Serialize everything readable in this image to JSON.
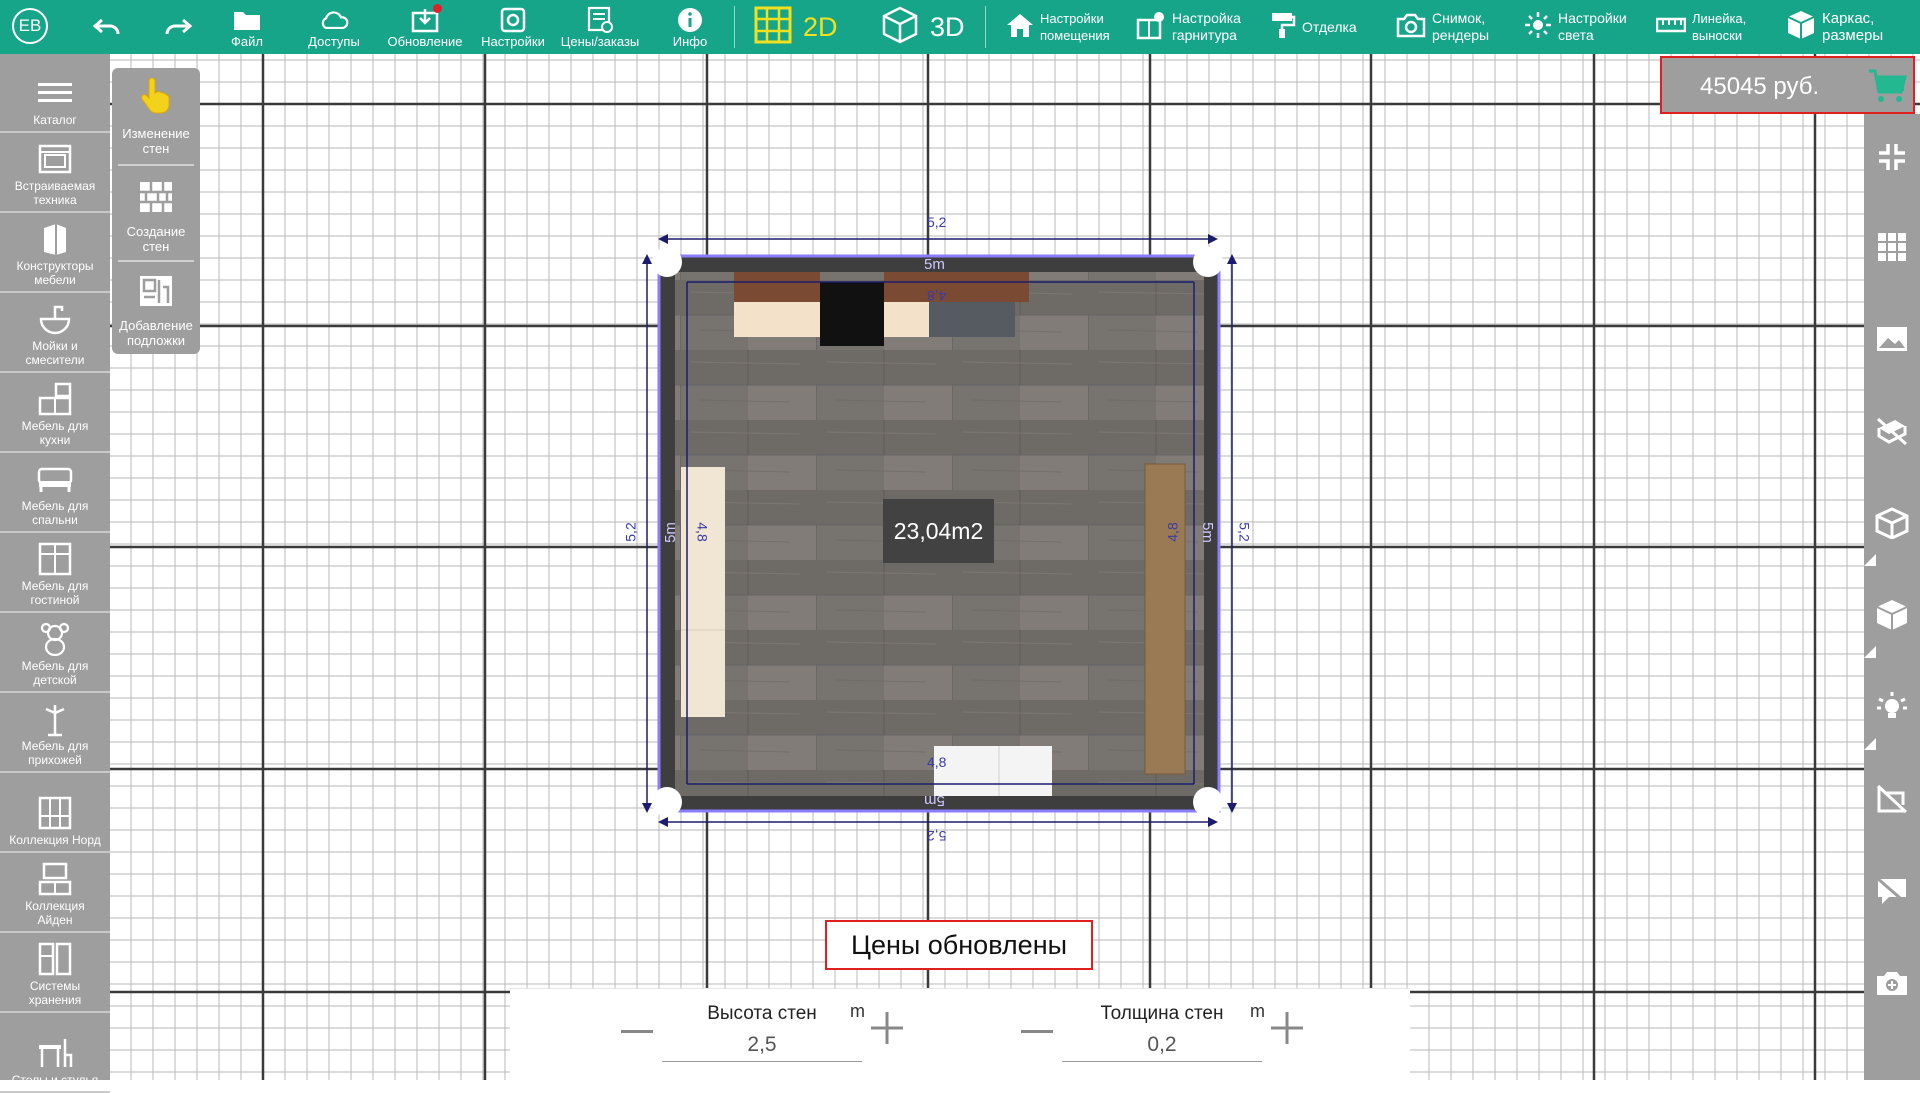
{
  "user": {
    "initials": "EB"
  },
  "toolbar": {
    "file": "Файл",
    "access": "Доступы",
    "update": "Обновление",
    "settings": "Настройки",
    "prices": "Цены/заказы",
    "info": "Инфо",
    "mode_2d": "2D",
    "mode_3d": "3D",
    "room_settings": "Настройки\nпомещения",
    "set_settings": "Настройка\nгарнитура",
    "finishing": "Отделка",
    "snapshot": "Снимок,\nрендеры",
    "light_settings": "Настройки\nсвета",
    "ruler": "Линейка,\nвыноски",
    "frame": "Каркас,\nразмеры"
  },
  "sidebar": {
    "items": [
      {
        "label": "Каталог",
        "icon": "menu-icon"
      },
      {
        "label": "Встраиваемая\nтехника",
        "icon": "oven-icon"
      },
      {
        "label": "Конструкторы\nмебели",
        "icon": "cabinet-icon"
      },
      {
        "label": "Мойки и\nсмесители",
        "icon": "sink-icon"
      },
      {
        "label": "Мебель для\nкухни",
        "icon": "kitchen-icon"
      },
      {
        "label": "Мебель для\nспальни",
        "icon": "bed-icon"
      },
      {
        "label": "Мебель для\nгостиной",
        "icon": "wardrobe-icon"
      },
      {
        "label": "Мебель для\nдетской",
        "icon": "teddy-bear-icon"
      },
      {
        "label": "Мебель для\nприхожей",
        "icon": "coat-rack-icon"
      },
      {
        "label": "Коллекция Норд",
        "icon": "shelf-icon"
      },
      {
        "label": "Коллекция\nАйден",
        "icon": "tv-stand-icon"
      },
      {
        "label": "Системы\nхранения",
        "icon": "storage-icon"
      },
      {
        "label": "Столы и стулья",
        "icon": "table-chair-icon"
      }
    ]
  },
  "tools": {
    "edit_walls": "Изменение\nстен",
    "create_walls": "Создание\nстен",
    "add_underlay": "Добавление\nподложки"
  },
  "price": {
    "value": "45045 руб."
  },
  "room": {
    "area": "23,04m2",
    "outer_dim": "5,2",
    "wall_dim": "5m",
    "inner_dim": "4,8"
  },
  "toast": {
    "text": "Цены обновлены"
  },
  "params": {
    "height": {
      "title": "Высота стен",
      "unit": "m",
      "value": "2,5"
    },
    "thickness": {
      "title": "Толщина стен",
      "unit": "m",
      "value": "0,2"
    }
  },
  "colors": {
    "topbar": "#17a589",
    "sidebar": "#9e9e9e",
    "highlight": "#e02020",
    "active_mode": "#f0e020",
    "wall": "#3e3e3e",
    "dimension": "#1c1c6e"
  }
}
